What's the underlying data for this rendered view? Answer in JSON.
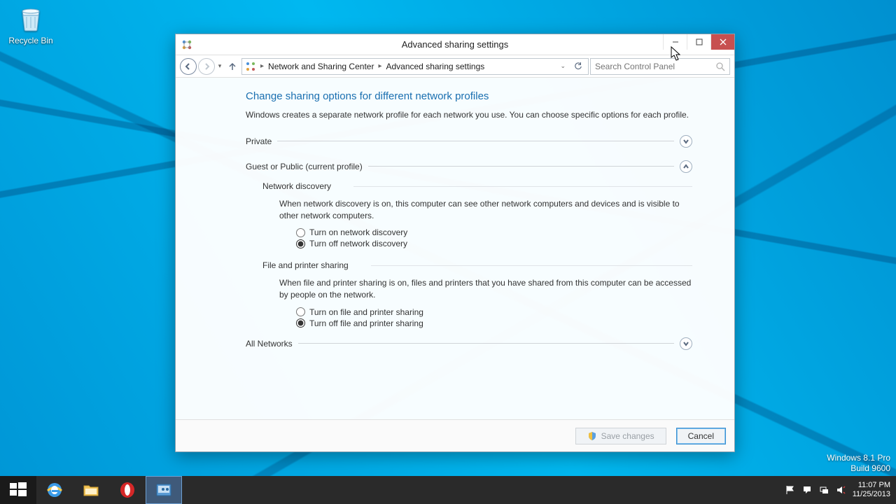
{
  "desktop": {
    "recycle_bin": "Recycle Bin"
  },
  "window": {
    "title": "Advanced sharing settings",
    "breadcrumb": {
      "a": "Network and Sharing Center",
      "b": "Advanced sharing settings"
    },
    "search_placeholder": "Search Control Panel"
  },
  "content": {
    "heading": "Change sharing options for different network profiles",
    "description": "Windows creates a separate network profile for each network you use. You can choose specific options for each profile.",
    "sections": {
      "private": "Private",
      "guest": "Guest or Public (current profile)",
      "all": "All Networks"
    },
    "network_discovery": {
      "title": "Network discovery",
      "desc": "When network discovery is on, this computer can see other network computers and devices and is visible to other network computers.",
      "opt_on": "Turn on network discovery",
      "opt_off": "Turn off network discovery"
    },
    "file_printer": {
      "title": "File and printer sharing",
      "desc": "When file and printer sharing is on, files and printers that you have shared from this computer can be accessed by people on the network.",
      "opt_on": "Turn on file and printer sharing",
      "opt_off": "Turn off file and printer sharing"
    }
  },
  "footer": {
    "save": "Save changes",
    "cancel": "Cancel"
  },
  "watermark": {
    "line1": "Windows 8.1 Pro",
    "line2": "Build 9600"
  },
  "taskbar": {
    "time": "11:07 PM",
    "date": "11/25/2013"
  }
}
